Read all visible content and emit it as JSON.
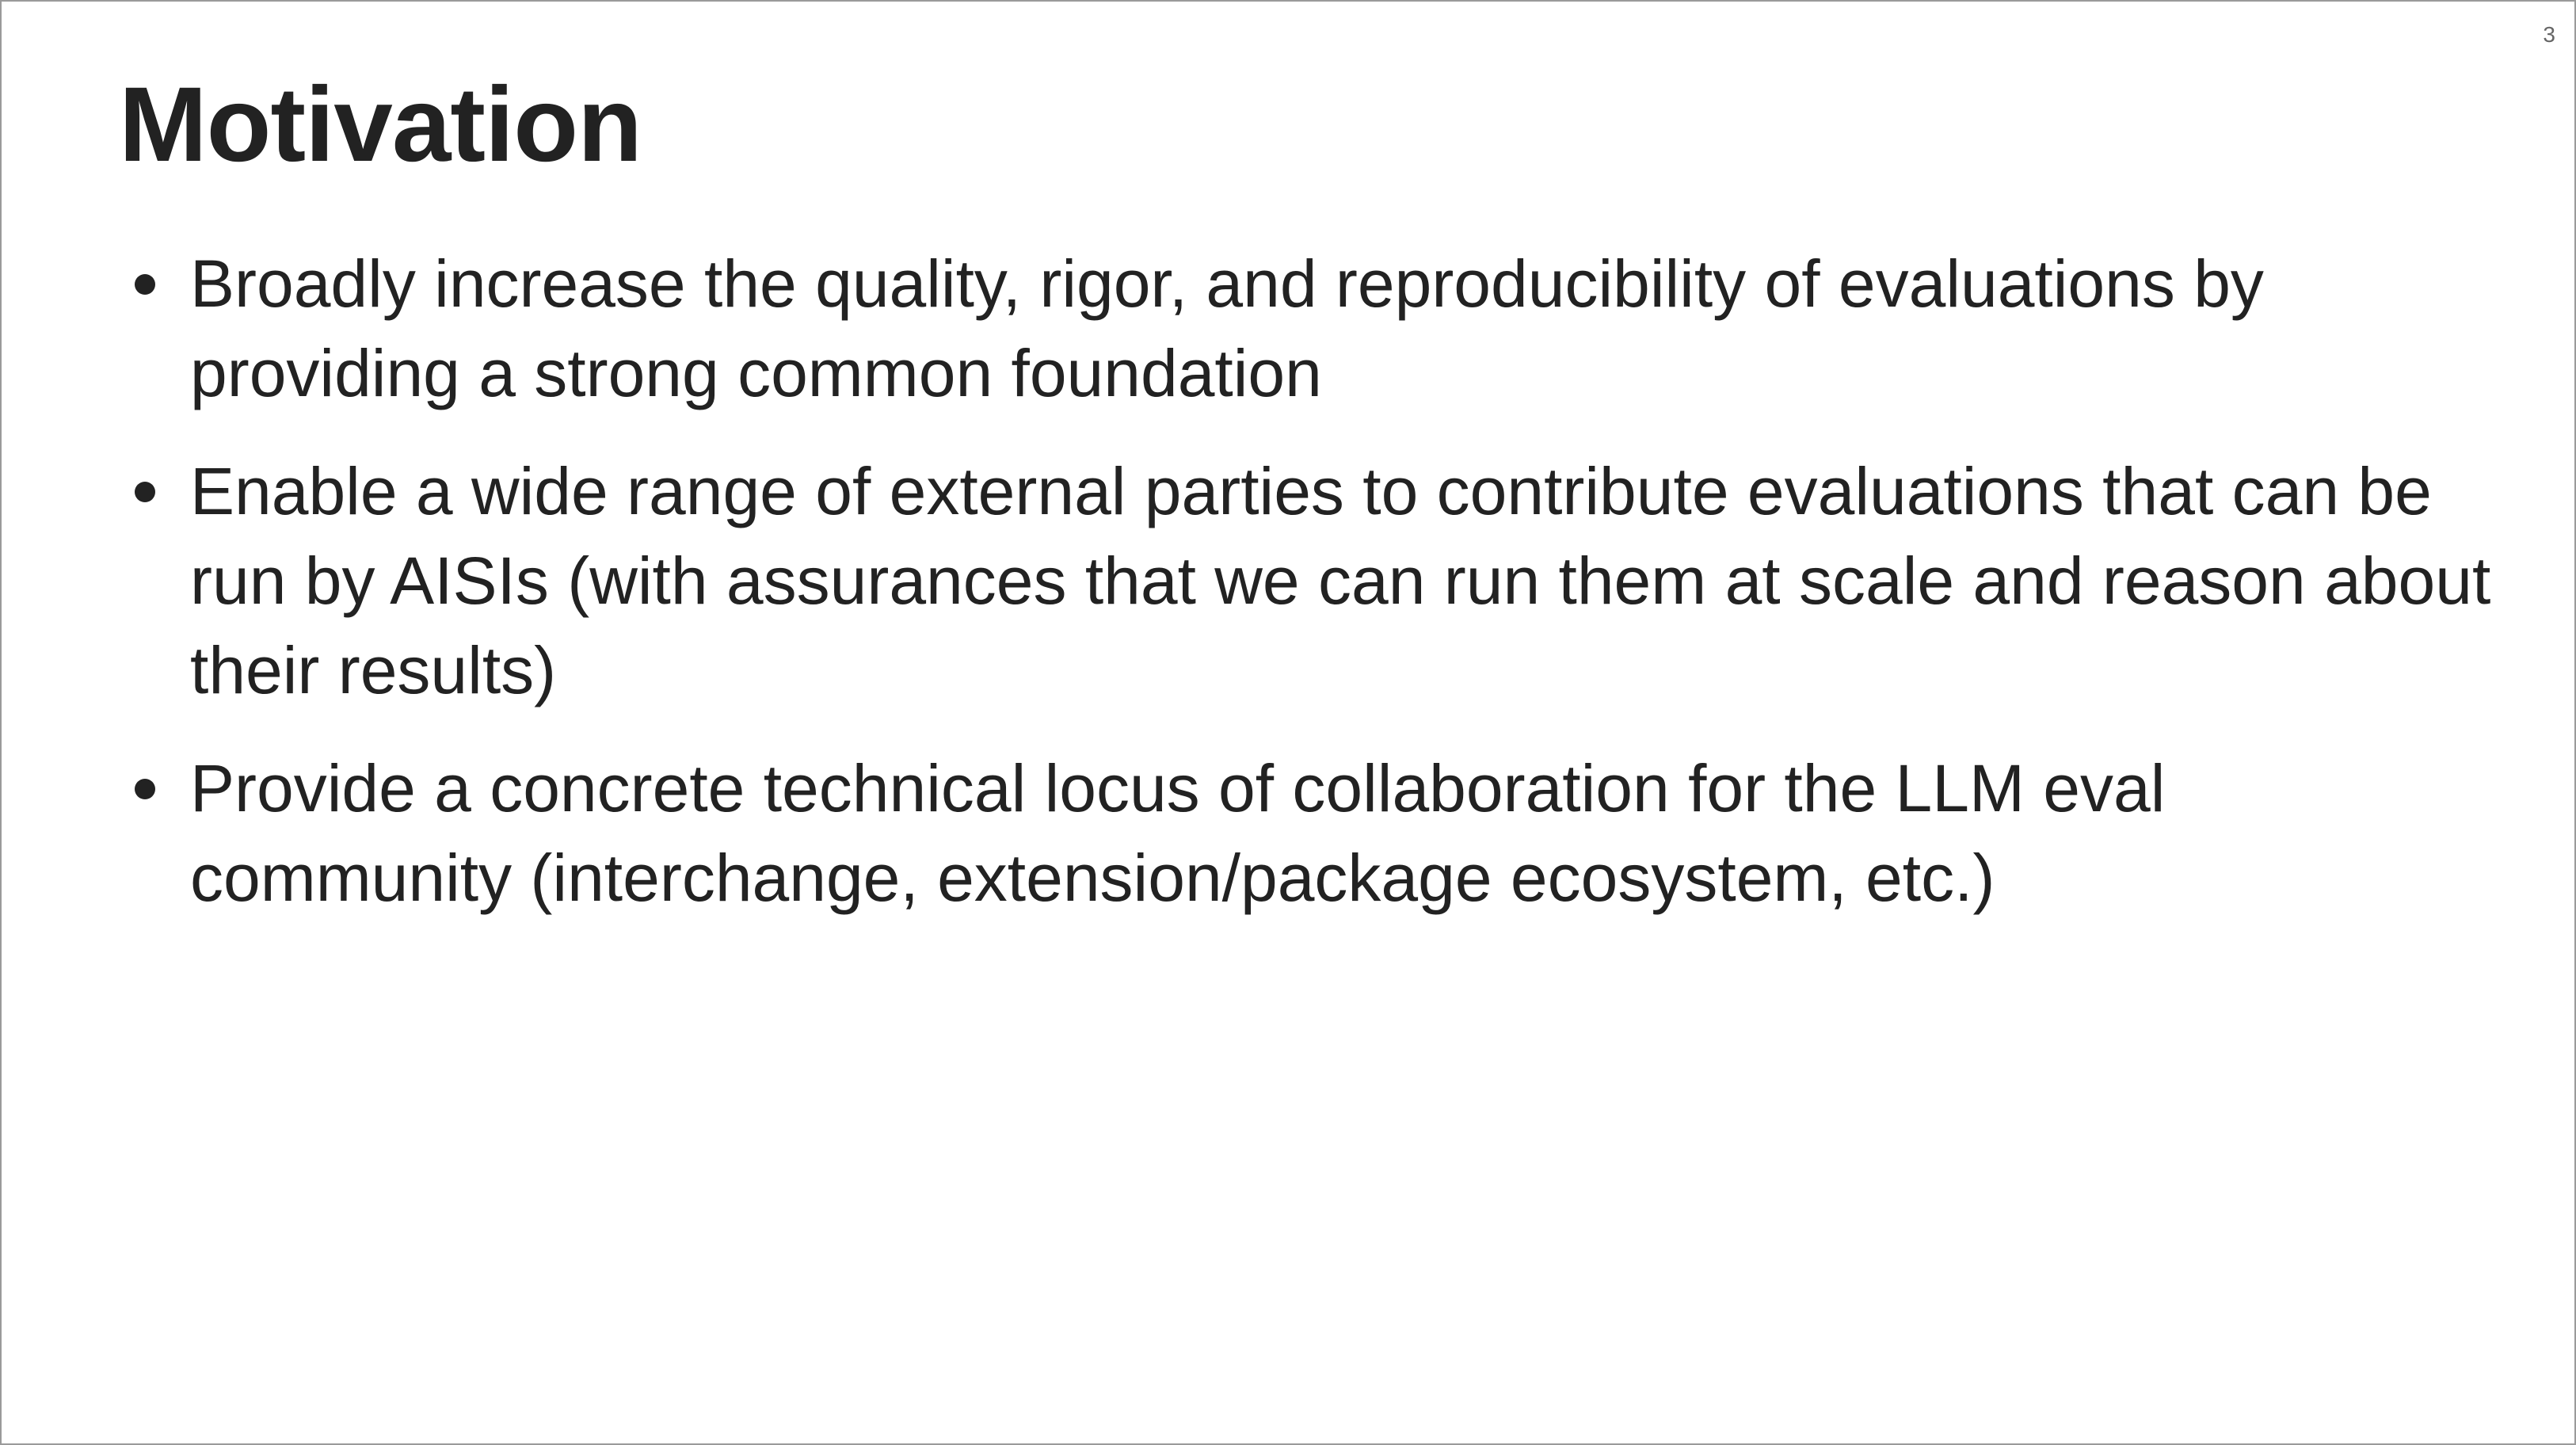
{
  "slide": {
    "page_number": "3",
    "title": "Motivation",
    "bullets": [
      {
        "lines": [
          "Broadly increase the quality, rigor, and reproducibility of evaluations by",
          "providing a strong common foundation"
        ]
      },
      {
        "lines": [
          "Enable a wide range of external parties to contribute evaluations that can be",
          "run by AISIs (with assurances that we can run them at scale and reason about",
          "their results)"
        ]
      },
      {
        "lines": [
          "Provide a concrete technical locus of collaboration for the LLM eval",
          "community (interchange, extension/package ecosystem, etc.)"
        ]
      }
    ]
  },
  "colors": {
    "text": "#222222",
    "background": "#ffffff",
    "page_number": "#666666",
    "border": "#9a9a9a"
  }
}
